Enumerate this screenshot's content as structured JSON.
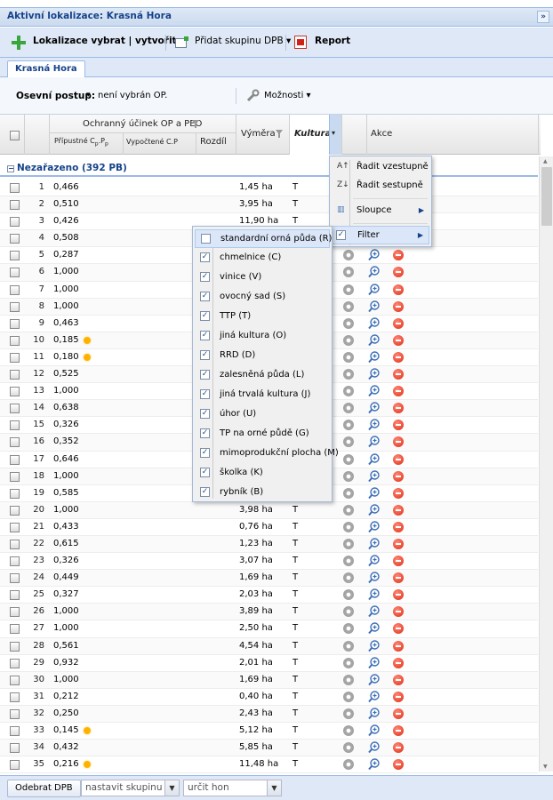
{
  "panel": {
    "title": "Aktivní lokalizace: Krasná Hora",
    "collapse_icon": "»"
  },
  "toolbar": {
    "create_label": "Lokalizace vybrat | vytvořit",
    "add_group_label": "Přidat skupinu DPB ▾",
    "report_label": "Report"
  },
  "tabs": [
    {
      "label": "Krasná Hora"
    }
  ],
  "seedbar": {
    "seeding_label": "Osevní postup:",
    "seeding_value": "není vybrán OP.",
    "options_label": "Možnosti ▾"
  },
  "grid": {
    "group_header": "Ochranný účinek OP a PEO",
    "col_allowed": "Přípustné C",
    "col_allowed_sub1": "p",
    "col_allowed_mid": ".P",
    "col_allowed_sub2": "p",
    "col_computed": "Vypočtené C.P",
    "col_diff": "Rozdíl",
    "col_area": "Výměra",
    "col_culture": "Kultura",
    "col_actions": "Akce",
    "group_row": "Nezařazeno (392 PB)",
    "rows": [
      {
        "n": "1",
        "v": "0,466",
        "a": "1,45 ha",
        "k": "T",
        "dot": false
      },
      {
        "n": "2",
        "v": "0,510",
        "a": "3,95 ha",
        "k": "T",
        "dot": false
      },
      {
        "n": "3",
        "v": "0,426",
        "a": "11,90 ha",
        "k": "T",
        "dot": false
      },
      {
        "n": "4",
        "v": "0,508",
        "a": "",
        "k": "",
        "dot": false
      },
      {
        "n": "5",
        "v": "0,287",
        "a": "",
        "k": "",
        "dot": false
      },
      {
        "n": "6",
        "v": "1,000",
        "a": "",
        "k": "",
        "dot": false
      },
      {
        "n": "7",
        "v": "1,000",
        "a": "",
        "k": "",
        "dot": false
      },
      {
        "n": "8",
        "v": "1,000",
        "a": "",
        "k": "",
        "dot": false
      },
      {
        "n": "9",
        "v": "0,463",
        "a": "",
        "k": "",
        "dot": false
      },
      {
        "n": "10",
        "v": "0,185",
        "a": "",
        "k": "",
        "dot": true
      },
      {
        "n": "11",
        "v": "0,180",
        "a": "",
        "k": "",
        "dot": true
      },
      {
        "n": "12",
        "v": "0,525",
        "a": "",
        "k": "",
        "dot": false
      },
      {
        "n": "13",
        "v": "1,000",
        "a": "",
        "k": "",
        "dot": false
      },
      {
        "n": "14",
        "v": "0,638",
        "a": "",
        "k": "",
        "dot": false
      },
      {
        "n": "15",
        "v": "0,326",
        "a": "",
        "k": "",
        "dot": false
      },
      {
        "n": "16",
        "v": "0,352",
        "a": "",
        "k": "",
        "dot": false
      },
      {
        "n": "17",
        "v": "0,646",
        "a": "",
        "k": "",
        "dot": false
      },
      {
        "n": "18",
        "v": "1,000",
        "a": "",
        "k": "",
        "dot": false
      },
      {
        "n": "19",
        "v": "0,585",
        "a": "",
        "k": "",
        "dot": false
      },
      {
        "n": "20",
        "v": "1,000",
        "a": "3,98 ha",
        "k": "T",
        "dot": false
      },
      {
        "n": "21",
        "v": "0,433",
        "a": "0,76 ha",
        "k": "T",
        "dot": false
      },
      {
        "n": "22",
        "v": "0,615",
        "a": "1,23 ha",
        "k": "T",
        "dot": false
      },
      {
        "n": "23",
        "v": "0,326",
        "a": "3,07 ha",
        "k": "T",
        "dot": false
      },
      {
        "n": "24",
        "v": "0,449",
        "a": "1,69 ha",
        "k": "T",
        "dot": false
      },
      {
        "n": "25",
        "v": "0,327",
        "a": "2,03 ha",
        "k": "T",
        "dot": false
      },
      {
        "n": "26",
        "v": "1,000",
        "a": "3,89 ha",
        "k": "T",
        "dot": false
      },
      {
        "n": "27",
        "v": "1,000",
        "a": "2,50 ha",
        "k": "T",
        "dot": false
      },
      {
        "n": "28",
        "v": "0,561",
        "a": "4,54 ha",
        "k": "T",
        "dot": false
      },
      {
        "n": "29",
        "v": "0,932",
        "a": "2,01 ha",
        "k": "T",
        "dot": false
      },
      {
        "n": "30",
        "v": "1,000",
        "a": "1,69 ha",
        "k": "T",
        "dot": false
      },
      {
        "n": "31",
        "v": "0,212",
        "a": "0,40 ha",
        "k": "T",
        "dot": false
      },
      {
        "n": "32",
        "v": "0,250",
        "a": "2,43 ha",
        "k": "T",
        "dot": false
      },
      {
        "n": "33",
        "v": "0,145",
        "a": "5,12 ha",
        "k": "T",
        "dot": true
      },
      {
        "n": "34",
        "v": "0,432",
        "a": "5,85 ha",
        "k": "T",
        "dot": false
      },
      {
        "n": "35",
        "v": "0,216",
        "a": "11,48 ha",
        "k": "T",
        "dot": true
      }
    ]
  },
  "column_menu": {
    "sort_asc": "Řadit vzestupně",
    "sort_desc": "Řadit sestupně",
    "columns": "Sloupce",
    "filter": "Filter"
  },
  "filter_menu": [
    {
      "label": "standardní orná půda (R)",
      "checked": false
    },
    {
      "label": "chmelnice (C)",
      "checked": true
    },
    {
      "label": "vinice (V)",
      "checked": true
    },
    {
      "label": "ovocný sad (S)",
      "checked": true
    },
    {
      "label": "TTP (T)",
      "checked": true
    },
    {
      "label": "jiná kultura (O)",
      "checked": true
    },
    {
      "label": "RRD (D)",
      "checked": true
    },
    {
      "label": "zalesněná půda (L)",
      "checked": true
    },
    {
      "label": "jiná trvalá kultura (J)",
      "checked": true
    },
    {
      "label": "úhor (U)",
      "checked": true
    },
    {
      "label": "TP na orné půdě (G)",
      "checked": true
    },
    {
      "label": "mimoprodukční plocha (M)",
      "checked": true
    },
    {
      "label": "školka (K)",
      "checked": true
    },
    {
      "label": "rybník (B)",
      "checked": true
    }
  ],
  "bottombar": {
    "remove_button": "Odebrat DPB",
    "group_combo": "nastavit skupinu",
    "score_combo": "určit hon"
  },
  "colors": {
    "accent": "#15428b",
    "border": "#99bbe8",
    "warning_dot": "#ffb300",
    "delete": "#e02a10"
  }
}
